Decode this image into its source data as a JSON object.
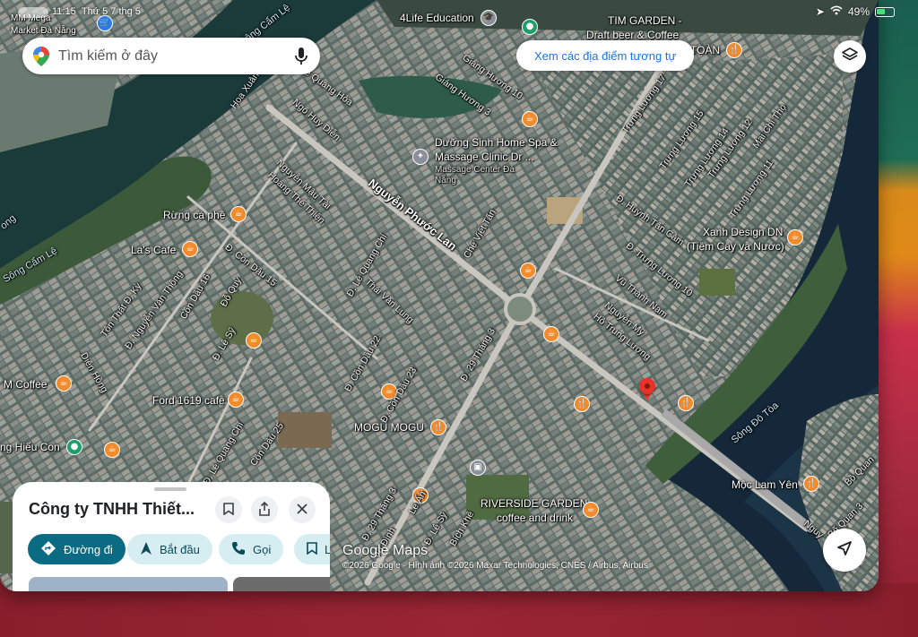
{
  "status_bar": {
    "time": "11:15",
    "date": "Thứ 5 7 thg 5",
    "battery": "49%"
  },
  "search": {
    "placeholder": "Tìm kiếm ở đây"
  },
  "similar_places_label": "Xem các địa điểm tương tự",
  "map": {
    "logo": "Google Maps",
    "attribution": "©2026 Google · Hình ảnh ©2026 Maxar Technologies, CNES / Airbus, Airbus",
    "pois": [
      {
        "name": "MM Mega Market Đà Nẵng",
        "line1": "MM Mega",
        "line2": "Market Đà Nẵng"
      },
      {
        "name": "4Life Education",
        "line1": "4Life Education"
      },
      {
        "name": "TIM GARDEN",
        "line1": "TIM GARDEN -",
        "line2": "Draft beer & Coffee"
      },
      {
        "name": "TOÀN",
        "line1": "TOÀN"
      },
      {
        "name": "Dưỡng Sinh Home Spa",
        "line1": "Dưỡng Sinh Home Spa &",
        "line2": "Massage Clinic Dr ...",
        "line3": "Massage Center Đà",
        "line4": "Nẵng"
      },
      {
        "name": "Rừng cà phê",
        "line1": "Rừng cà phê"
      },
      {
        "name": "La's Cafe",
        "line1": "La's Cafe"
      },
      {
        "name": "Xanh Design DN",
        "line1": "Xanh Design DN",
        "line2": "(Tiệm Cây và Nước)"
      },
      {
        "name": "M Coffee",
        "line1": "M Coffee"
      },
      {
        "name": "Ford 1619 cafe",
        "line1": "Ford 1619 cafe"
      },
      {
        "name": "MOGU MOGU",
        "line1": "MOGU MOGU"
      },
      {
        "name": "Hiếu Con",
        "line1": "ng Hiếu Con"
      },
      {
        "name": "RIVERSIDE GARDEN",
        "line1": "RIVERSIDE GARDEN",
        "line2": "coffee and drink"
      },
      {
        "name": "Mộc Lam Yên",
        "line1": "Mộc Lam Yên"
      }
    ],
    "streets": [
      "Lê Quang Hòa",
      "Ngô Huy Diễn",
      "Hoa Xuân",
      "Giáng Hương 10",
      "Giáng Hương 3",
      "Trưng Lương 17",
      "Trưng Lương 15",
      "Trưng Lương 14",
      "Trưng Lương 12",
      "Mai Chí Thọ",
      "Trưng Lương 11",
      "Nguyễn Phước Lan",
      "Chế Viết Tấn",
      "Đ. Huỳnh Tấn Cảm",
      "Đ. Trưng Lương 10",
      "Vũ Thành Nam",
      "Nguyễn Mỹ",
      "Hồ Trung Lượng",
      "Đ. 29 Tháng 3",
      "Đ. Lê Quang Chí",
      "Nguyễn Mậu Tài",
      "Hoàng Thế Thiện",
      "Thái Văn Lung",
      "Đ. Cồn Dầu 15",
      "Tôn Thất Đ. Kỳ",
      "Đ. Nguyễn Văn Thông",
      "Cồn Dầu 16",
      "Đỗ Quỳ",
      "Đ. Lê Sỹ",
      "Đ. Cồn Dầu 22",
      "Đ. Cồn Dầu 23",
      "Diên Hồng",
      "Đ. Lê Quang Chí",
      "Cồn Dầu 25",
      "Lê Ấn",
      "Đ. Lê Sỹ",
      "Bích Khê",
      "Vũ Đình",
      "Đ. 29 Tháng 3",
      "Bố Quan 3",
      "Nguy",
      "Bồ Quan"
    ],
    "water_labels": [
      "Sông Cẩm Lệ",
      "Sông Cẩm Lệ",
      "Sông Đô Tòa",
      "ong"
    ]
  },
  "place_sheet": {
    "title": "Công ty TNHH Thiết...",
    "actions": {
      "directions": "Đường đi",
      "start": "Bắt đầu",
      "call": "Gọi",
      "save": "L"
    }
  }
}
